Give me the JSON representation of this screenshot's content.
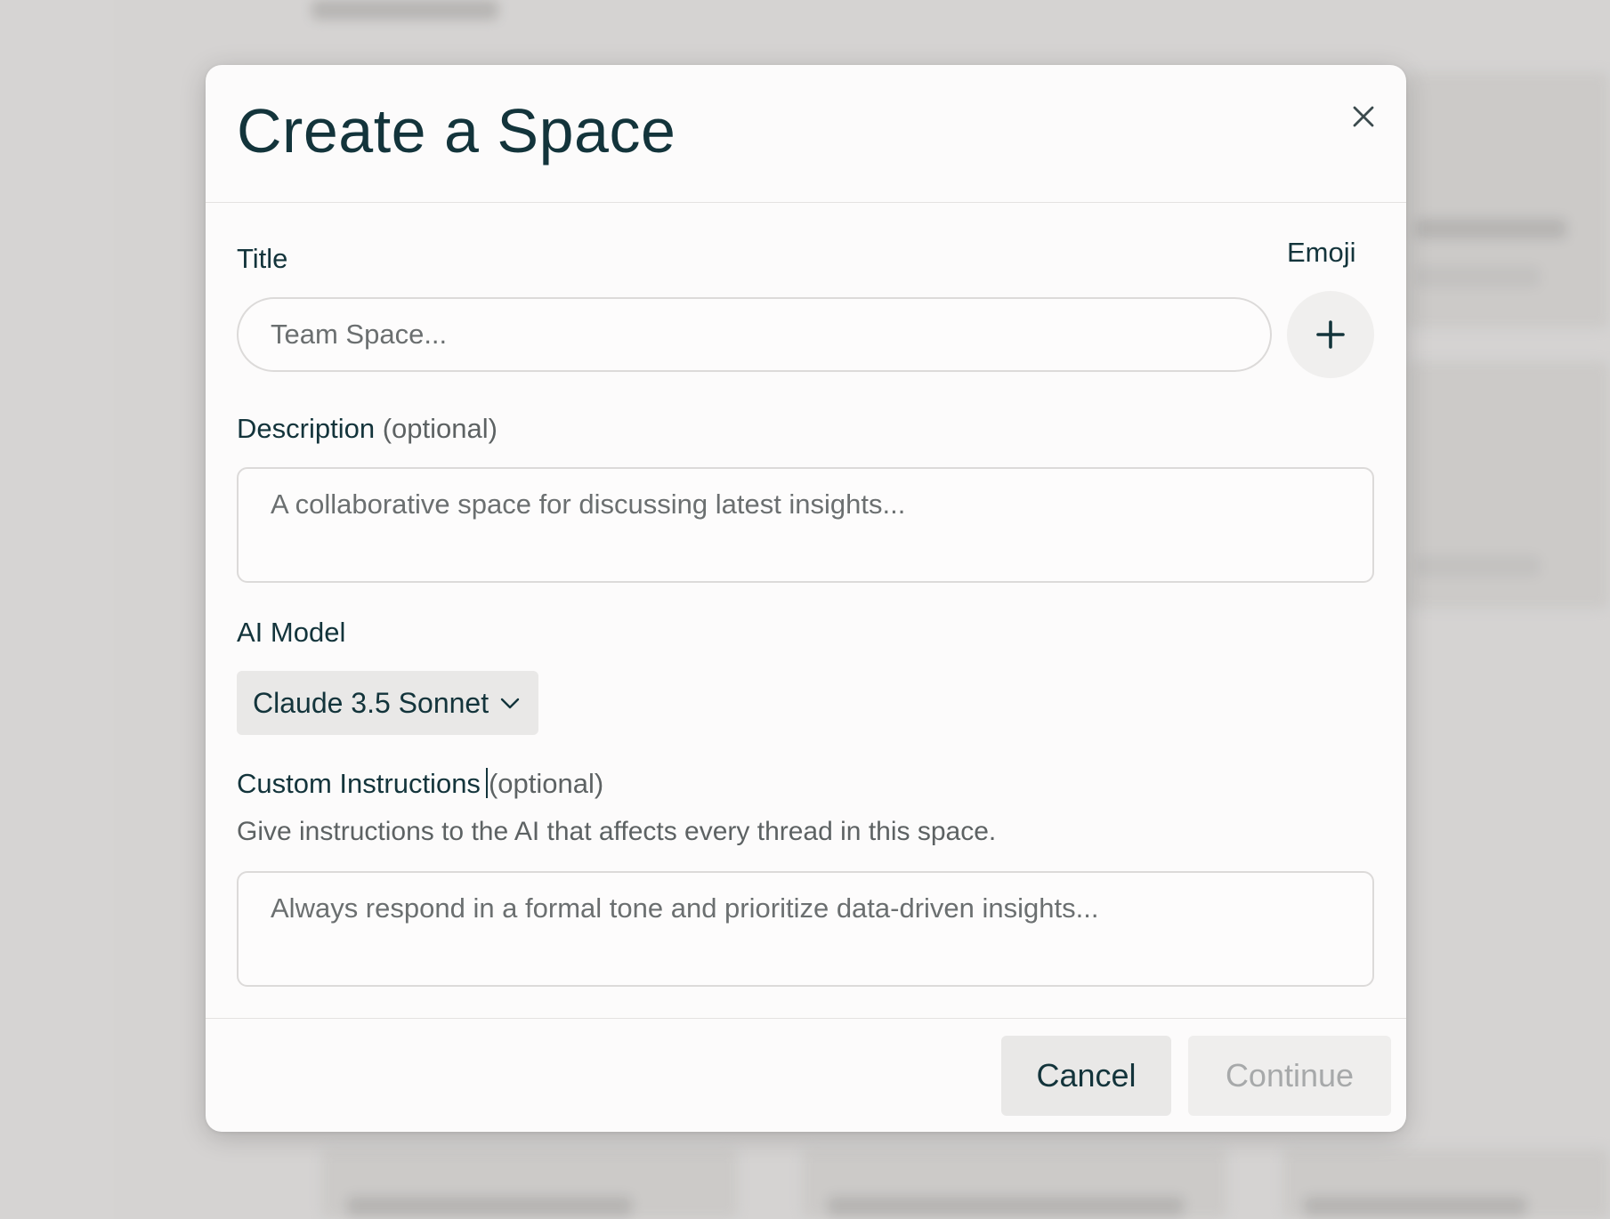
{
  "dialog": {
    "title": "Create a Space",
    "close_icon": "close-icon"
  },
  "title_field": {
    "label": "Title",
    "placeholder": "Team Space...",
    "value": ""
  },
  "emoji": {
    "label": "Emoji",
    "icon": "plus-icon"
  },
  "description_field": {
    "label": "Description",
    "optional": "(optional)",
    "placeholder": "A collaborative space for discussing latest insights...",
    "value": ""
  },
  "ai_model": {
    "label": "AI Model",
    "selected": "Claude 3.5 Sonnet",
    "icon": "chevron-down-icon"
  },
  "custom_instructions": {
    "label": "Custom Instructions",
    "optional": "(optional)",
    "hint": "Give instructions to the AI that affects every thread in this space.",
    "placeholder": "Always respond in a formal tone and prioritize data-driven insights...",
    "value": ""
  },
  "footer": {
    "cancel_label": "Cancel",
    "continue_label": "Continue"
  },
  "colors": {
    "text": "#13343b",
    "muted": "#5d6263",
    "border": "#dcdad9",
    "button_bg": "#e9e8e7",
    "disabled_text": "#a7a9aa"
  }
}
